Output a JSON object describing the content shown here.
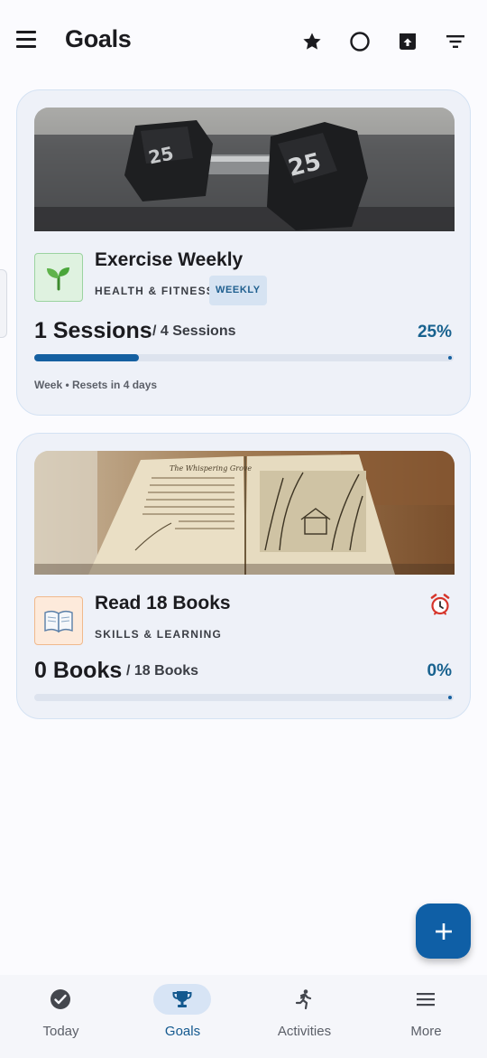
{
  "app": {
    "title": "Goals"
  },
  "toolbar": {
    "icons": [
      "menu-icon",
      "star-icon",
      "circle-icon",
      "archive-icon",
      "filter-icon"
    ]
  },
  "goals": [
    {
      "title": "Exercise Weekly",
      "category": "HEALTH & FITNESS",
      "badge": "WEEKLY",
      "current": "1 Sessions",
      "target": "/ 4 Sessions",
      "percent": "25%",
      "progress": 0.25,
      "period": "Week • Resets in 4 days",
      "icon": "seedling-icon",
      "color": "#1560a1"
    },
    {
      "title": "Read 18 Books",
      "category": "SKILLS & LEARNING",
      "current": "0 Books",
      "target": "/ 18 Books",
      "percent": "0%",
      "progress": 0,
      "icon": "book-icon",
      "reminder_icon": "alarm-clock-icon"
    }
  ],
  "fab": {
    "icon": "plus-icon"
  },
  "bottom_nav": [
    {
      "label": "Today",
      "icon": "check-circle-icon"
    },
    {
      "label": "Goals",
      "icon": "trophy-icon",
      "active": true
    },
    {
      "label": "Activities",
      "icon": "running-icon"
    },
    {
      "label": "More",
      "icon": "menu-icon"
    }
  ],
  "colors": {
    "accent": "#0f5fa6",
    "card_bg": "#eef1f8",
    "progress_fill": "#1560a1"
  }
}
